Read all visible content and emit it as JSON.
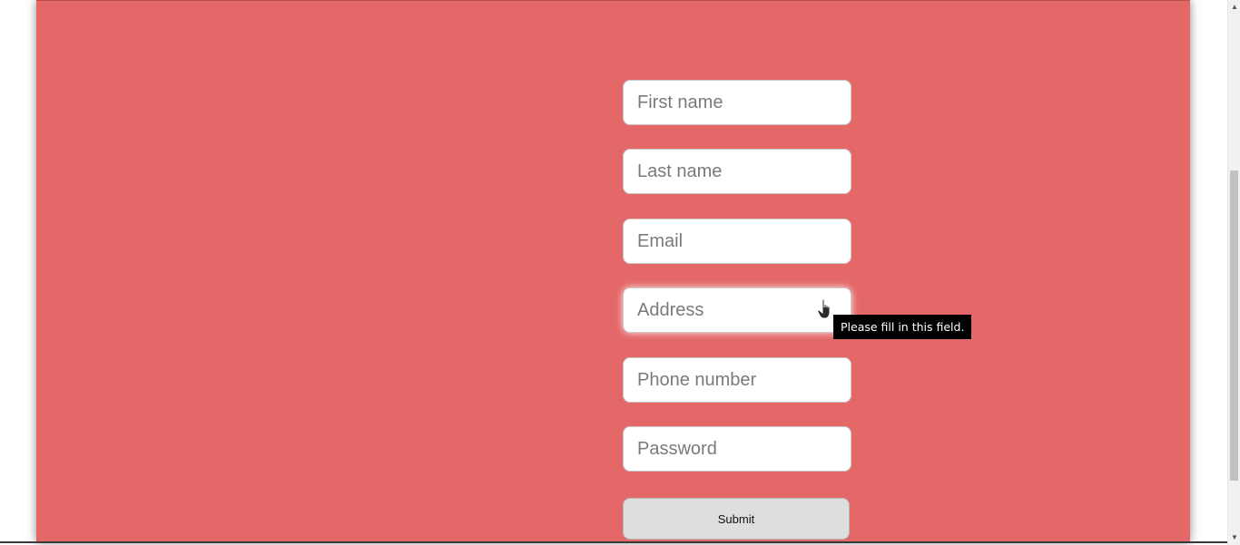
{
  "form": {
    "first_name_placeholder": "First name",
    "last_name_placeholder": "Last name",
    "email_placeholder": "Email",
    "address_placeholder": "Address",
    "phone_placeholder": "Phone number",
    "password_placeholder": "Password",
    "submit_label": "Submit"
  },
  "tooltip": {
    "text": "Please fill in this field."
  },
  "scrollbar": {
    "up_arrow": "▲",
    "down_arrow": "▼"
  },
  "colors": {
    "panel_background": "#e46868",
    "page_background": "#ffffff",
    "submit_background": "#dedede",
    "tooltip_background": "#000000"
  },
  "icons": {
    "cursor": "hand-pointer-icon"
  }
}
